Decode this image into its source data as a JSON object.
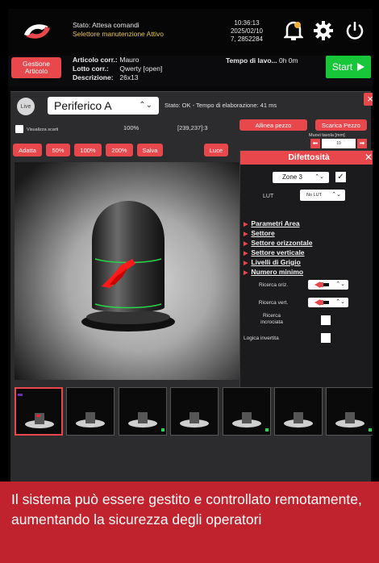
{
  "colors": {
    "accent": "#e8474c",
    "start": "#18c63a",
    "caption_bg": "#c0232d",
    "status_warn": "#e8c64a"
  },
  "header": {
    "status_line1": "Stato: Attesa comandi",
    "status_line2": "Selettore manutenzione Attivo",
    "time": "10:36:13",
    "date": "2025/02/10",
    "code": "7, 2852284",
    "icons": [
      "bell-icon",
      "gear-icon",
      "power-icon"
    ]
  },
  "article": {
    "gestione_label_1": "Gestione",
    "gestione_label_2": "Articolo",
    "art_key": "Articolo corr.:",
    "art_val": "Mauro",
    "lotto_key": "Lotto corr.:",
    "lotto_val": "Qwerty [open]",
    "descr_key": "Descrizione:",
    "descr_val": "26x13",
    "tempo_key": "Tempo di lavo...",
    "tempo_val": "0h 0m",
    "start_label": "Start"
  },
  "camera": {
    "live_label": "Live",
    "selected_camera": "Periferico A",
    "status": "Stato: OK - Tempo di elaborazione: 41 ms",
    "show_discards_label": "Visualizza scarti",
    "zoom_percent": "100%",
    "coords": "[239,237]:3",
    "align_label": "Allinea pezzo",
    "unload_label": "Scarica Pezzo",
    "move_table_label": "Muovi tavola [mm]",
    "move_value": "10",
    "zoom_buttons": [
      "Adatta",
      "50%",
      "100%",
      "200%",
      "Salva"
    ],
    "light_label": "Luce"
  },
  "difettosita": {
    "title": "Difettosità",
    "zone": "Zone 3",
    "lut_label": "LUT",
    "lut_value": "No LUT",
    "sections": [
      "Parametri Area",
      "Settore",
      "Settore orizzontale",
      "Settore verticale",
      "Livelli di Grigio",
      "Numero minimo"
    ],
    "ricerca_oriz": "Ricerca oriz.",
    "ricerca_vert": "Ricerca vert.",
    "ricerca_incrociata": "Ricerca incrociata",
    "logica_invertita": "Logica invertita"
  },
  "thumbnails_count": 7,
  "caption": "Il sistema può essere gestito e controllato remotamente, aumentando la sicurezza degli operatori"
}
